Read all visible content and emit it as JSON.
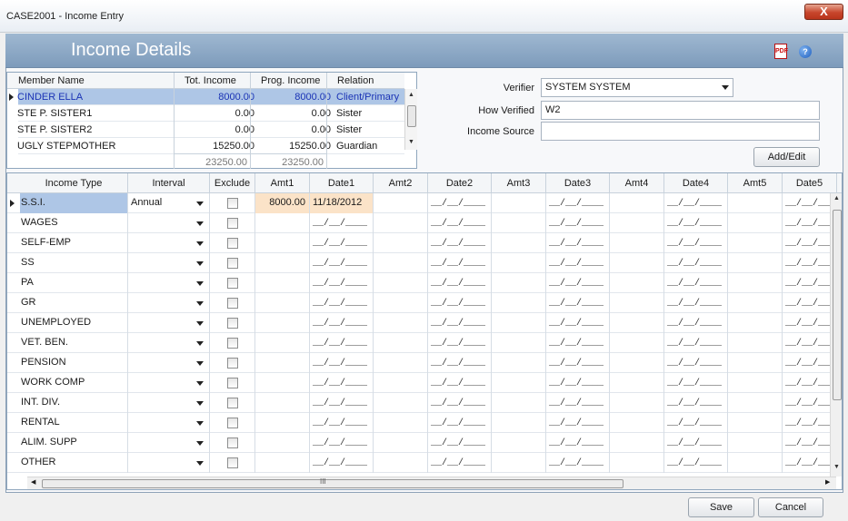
{
  "window": {
    "title": "CASE2001 - Income Entry",
    "close_label": "X"
  },
  "header": {
    "title": "Income Details"
  },
  "members": {
    "columns": [
      "Member Name",
      "Tot. Income",
      "Prog. Income",
      "Relation"
    ],
    "rows": [
      [
        "CINDER ELLA",
        "8000.00",
        "8000.00",
        "Client/Primary"
      ],
      [
        "STE P. SISTER1",
        "0.00",
        "0.00",
        "Sister"
      ],
      [
        "STE P. SISTER2",
        "0.00",
        "0.00",
        "Sister"
      ],
      [
        "UGLY STEPMOTHER",
        "15250.00",
        "15250.00",
        "Guardian"
      ]
    ],
    "totals": [
      "23250.00",
      "23250.00"
    ]
  },
  "verifier": {
    "verifier_label": "Verifier",
    "verifier_value": "SYSTEM  SYSTEM",
    "how_label": "How Verified",
    "how_value": "W2",
    "source_label": "Income Source",
    "source_value": "",
    "add_edit_label": "Add/Edit"
  },
  "income": {
    "columns": [
      "Income Type",
      "Interval",
      "Exclude",
      "Amt1",
      "Date1",
      "Amt2",
      "Date2",
      "Amt3",
      "Date3",
      "Amt4",
      "Date4",
      "Amt5",
      "Date5"
    ],
    "date_mask": "__/__/____",
    "rows": [
      {
        "type": "S.S.I.",
        "interval": "Annual",
        "amt1": "8000.00",
        "date1": "11/18/2012"
      },
      {
        "type": "WAGES",
        "interval": "",
        "amt1": "",
        "date1": ""
      },
      {
        "type": "SELF-EMP",
        "interval": "",
        "amt1": "",
        "date1": ""
      },
      {
        "type": "SS",
        "interval": "",
        "amt1": "",
        "date1": ""
      },
      {
        "type": "PA",
        "interval": "",
        "amt1": "",
        "date1": ""
      },
      {
        "type": "GR",
        "interval": "",
        "amt1": "",
        "date1": ""
      },
      {
        "type": "UNEMPLOYED",
        "interval": "",
        "amt1": "",
        "date1": ""
      },
      {
        "type": "VET. BEN.",
        "interval": "",
        "amt1": "",
        "date1": ""
      },
      {
        "type": "PENSION",
        "interval": "",
        "amt1": "",
        "date1": ""
      },
      {
        "type": "WORK COMP",
        "interval": "",
        "amt1": "",
        "date1": ""
      },
      {
        "type": "INT. DIV.",
        "interval": "",
        "amt1": "",
        "date1": ""
      },
      {
        "type": "RENTAL",
        "interval": "",
        "amt1": "",
        "date1": ""
      },
      {
        "type": "ALIM. SUPP",
        "interval": "",
        "amt1": "",
        "date1": ""
      },
      {
        "type": "OTHER",
        "interval": "",
        "amt1": "",
        "date1": ""
      }
    ]
  },
  "scroll": {
    "thumb_grip": "III",
    "grip_v": "≡"
  },
  "footer": {
    "save_label": "Save",
    "cancel_label": "Cancel"
  },
  "icons": {
    "pdf": "pdf-icon",
    "help": "help-icon"
  },
  "colors": {
    "header": "#8aa6c4",
    "selection": "#aec6e6",
    "amount_highlight": "#fbe3c8",
    "member_text": "#1a33b5"
  }
}
